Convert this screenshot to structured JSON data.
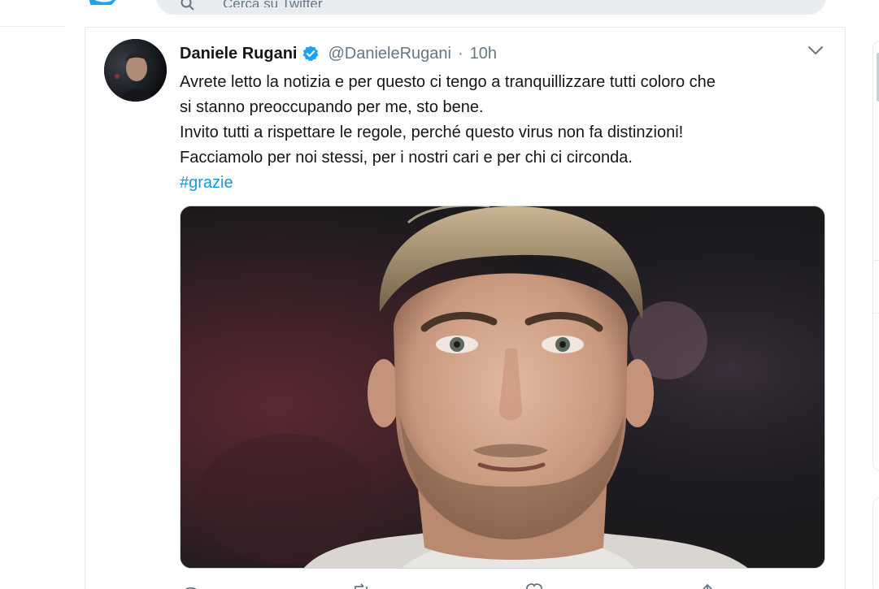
{
  "header": {
    "search_placeholder": "Cerca su Twitter",
    "logo_icon": "twitter-bird-icon"
  },
  "tweet": {
    "author_name": "Daniele Rugani",
    "handle": "@DanieleRugani",
    "separator": "·",
    "time": "10h",
    "verified": true,
    "lines": [
      "Avrete letto la notizia e per questo ci tengo a tranquillizzare tutti coloro che",
      "si stanno preoccupando per me, sto bene.",
      "Invito tutti a rispettare le regole, perché questo virus non fa distinzioni!",
      "Facciamolo per noi stessi, per i nostri cari e per chi ci circonda."
    ],
    "hashtag": "#grazie",
    "actions": [
      "reply-icon",
      "retweet-icon",
      "like-icon",
      "share-icon"
    ]
  },
  "colors": {
    "accent": "#1da1f2",
    "hashtag": "#1b95e0",
    "secondary_text": "#657786",
    "border": "#e6ecf0"
  }
}
